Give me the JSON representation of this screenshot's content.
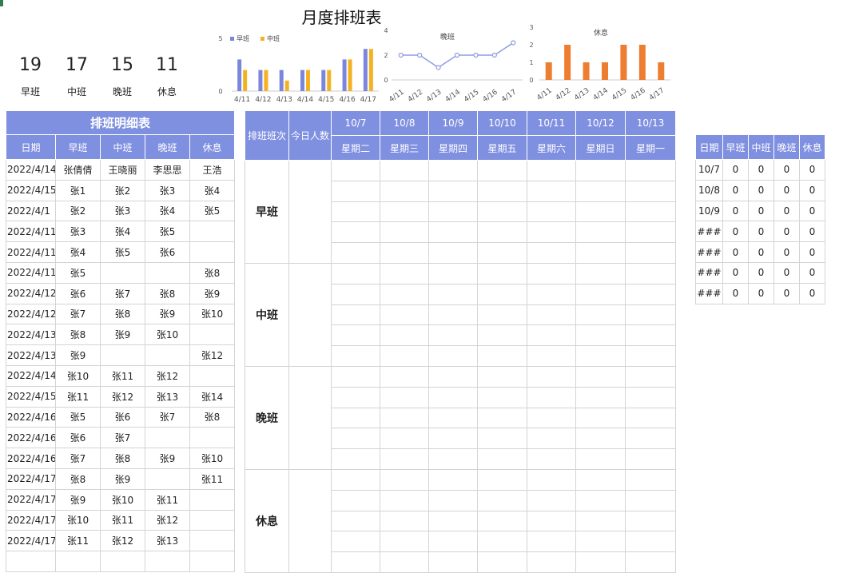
{
  "title": "月度排班表",
  "kpis": [
    {
      "value": "19",
      "label": "早班"
    },
    {
      "value": "17",
      "label": "中班"
    },
    {
      "value": "15",
      "label": "晚班"
    },
    {
      "value": "11",
      "label": "休息"
    }
  ],
  "charts": {
    "bar": {
      "type": "bar",
      "categories": [
        "4/11",
        "4/12",
        "4/13",
        "4/14",
        "4/15",
        "4/16",
        "4/17"
      ],
      "series": [
        {
          "name": "早班",
          "values": [
            3,
            2,
            2,
            2,
            2,
            3,
            4
          ],
          "color": "#7b85dc"
        },
        {
          "name": "中班",
          "values": [
            2,
            2,
            1,
            2,
            2,
            3,
            4
          ],
          "color": "#f4b223"
        }
      ],
      "ylim": [
        0,
        5
      ],
      "yticks": [
        "5",
        "0"
      ]
    },
    "line": {
      "type": "line",
      "title": "晚班",
      "categories": [
        "4/11",
        "4/12",
        "4/13",
        "4/14",
        "4/15",
        "4/16",
        "4/17"
      ],
      "values": [
        2,
        2,
        1,
        2,
        2,
        2,
        3
      ],
      "ylim": [
        0,
        4
      ],
      "yticks": [
        "4",
        "2",
        "0"
      ],
      "color": "#8f9ce3"
    },
    "rest": {
      "type": "bar",
      "title": "休息",
      "categories": [
        "4/11",
        "4/12",
        "4/13",
        "4/14",
        "4/15",
        "4/16",
        "4/17"
      ],
      "values": [
        1,
        2,
        1,
        1,
        2,
        2,
        1
      ],
      "ylim": [
        0,
        3
      ],
      "yticks": [
        "3",
        "2",
        "1",
        "0"
      ],
      "color": "#ed7d31"
    }
  },
  "detail": {
    "title": "排班明细表",
    "headers": [
      "日期",
      "早班",
      "中班",
      "晚班",
      "休息"
    ],
    "rows": [
      [
        "2022/4/14",
        "张倩倩",
        "王晓丽",
        "李思思",
        "王浩"
      ],
      [
        "2022/4/15",
        "张1",
        "张2",
        "张3",
        "张4"
      ],
      [
        "2022/4/1",
        "张2",
        "张3",
        "张4",
        "张5"
      ],
      [
        "2022/4/11",
        "张3",
        "张4",
        "张5",
        ""
      ],
      [
        "2022/4/11",
        "张4",
        "张5",
        "张6",
        ""
      ],
      [
        "2022/4/11",
        "张5",
        "",
        "",
        "张8"
      ],
      [
        "2022/4/12",
        "张6",
        "张7",
        "张8",
        "张9"
      ],
      [
        "2022/4/12",
        "张7",
        "张8",
        "张9",
        "张10"
      ],
      [
        "2022/4/13",
        "张8",
        "张9",
        "张10",
        ""
      ],
      [
        "2022/4/13",
        "张9",
        "",
        "",
        "张12"
      ],
      [
        "2022/4/14",
        "张10",
        "张11",
        "张12",
        ""
      ],
      [
        "2022/4/15",
        "张11",
        "张12",
        "张13",
        "张14"
      ],
      [
        "2022/4/16",
        "张5",
        "张6",
        "张7",
        "张8"
      ],
      [
        "2022/4/16",
        "张6",
        "张7",
        "",
        ""
      ],
      [
        "2022/4/16",
        "张7",
        "张8",
        "张9",
        "张10"
      ],
      [
        "2022/4/17",
        "张8",
        "张9",
        "",
        "张11"
      ],
      [
        "2022/4/17",
        "张9",
        "张10",
        "张11",
        ""
      ],
      [
        "2022/4/17",
        "张10",
        "张11",
        "张12",
        ""
      ],
      [
        "2022/4/17",
        "张11",
        "张12",
        "张13",
        ""
      ],
      [
        "",
        "",
        "",
        "",
        ""
      ]
    ]
  },
  "schedule": {
    "col1": "排班班次",
    "col2": "今日人数",
    "days": [
      {
        "date": "10/7",
        "weekday": "星期二"
      },
      {
        "date": "10/8",
        "weekday": "星期三"
      },
      {
        "date": "10/9",
        "weekday": "星期四"
      },
      {
        "date": "10/10",
        "weekday": "星期五"
      },
      {
        "date": "10/11",
        "weekday": "星期六"
      },
      {
        "date": "10/12",
        "weekday": "星期日"
      },
      {
        "date": "10/13",
        "weekday": "星期一"
      }
    ],
    "shifts": [
      "早班",
      "中班",
      "晚班",
      "休息"
    ]
  },
  "summary": {
    "headers": [
      "日期",
      "早班",
      "中班",
      "晚班",
      "休息"
    ],
    "rows": [
      [
        "10/7",
        "0",
        "0",
        "0",
        "0"
      ],
      [
        "10/8",
        "0",
        "0",
        "0",
        "0"
      ],
      [
        "10/9",
        "0",
        "0",
        "0",
        "0"
      ],
      [
        "###",
        "0",
        "0",
        "0",
        "0"
      ],
      [
        "###",
        "0",
        "0",
        "0",
        "0"
      ],
      [
        "###",
        "0",
        "0",
        "0",
        "0"
      ],
      [
        "###",
        "0",
        "0",
        "0",
        "0"
      ]
    ]
  }
}
